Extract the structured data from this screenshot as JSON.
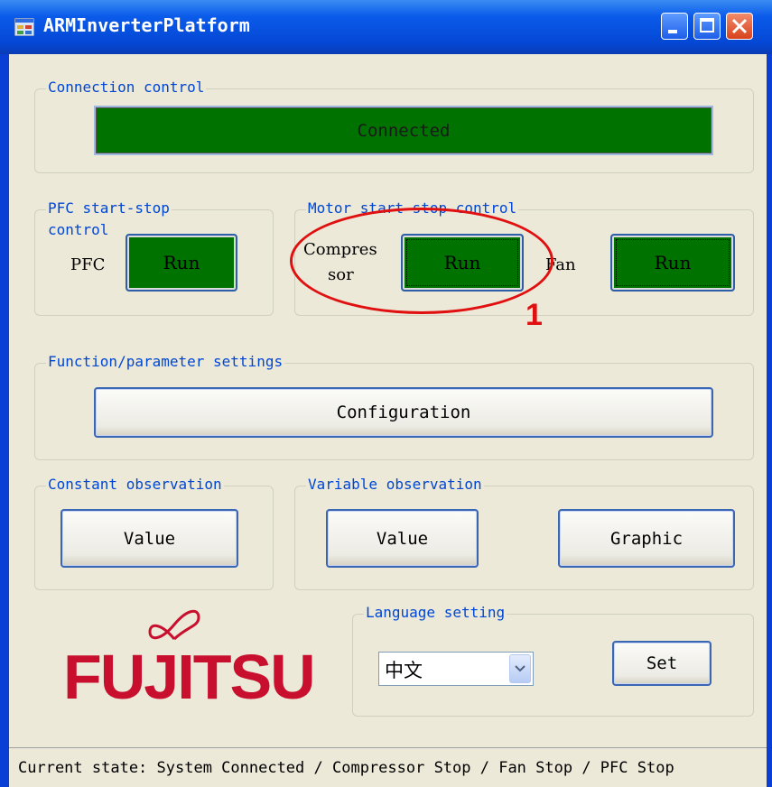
{
  "window": {
    "title": "ARMInverterPlatform",
    "icon": "app-window-icon",
    "controls": [
      "minimize-icon",
      "maximize-icon",
      "close-icon"
    ]
  },
  "connection": {
    "group_label": "Connection control",
    "status": "Connected",
    "status_color": "#007200"
  },
  "pfc": {
    "group_label_line1": "PFC start-stop",
    "group_label_line2": "control",
    "label": "PFC",
    "button": "Run"
  },
  "motor": {
    "group_label": "Motor start-stop control",
    "compressor_label_line1": "Compres",
    "compressor_label_line2": "sor",
    "compressor_button": "Run",
    "fan_label": "Fan",
    "fan_button": "Run"
  },
  "function": {
    "group_label": "Function/parameter settings",
    "button": "Configuration"
  },
  "constant": {
    "group_label": "Constant observation",
    "button": "Value"
  },
  "variable": {
    "group_label": "Variable observation",
    "value_button": "Value",
    "graphic_button": "Graphic"
  },
  "language": {
    "group_label": "Language setting",
    "selected": "中文",
    "set_button": "Set"
  },
  "logo": {
    "text": "FUJITSU",
    "color": "#c8102e"
  },
  "status_bar": {
    "text": "Current state: System Connected / Compressor Stop / Fan Stop / PFC Stop"
  },
  "annotation": {
    "number": "1",
    "color": "#e01010"
  }
}
